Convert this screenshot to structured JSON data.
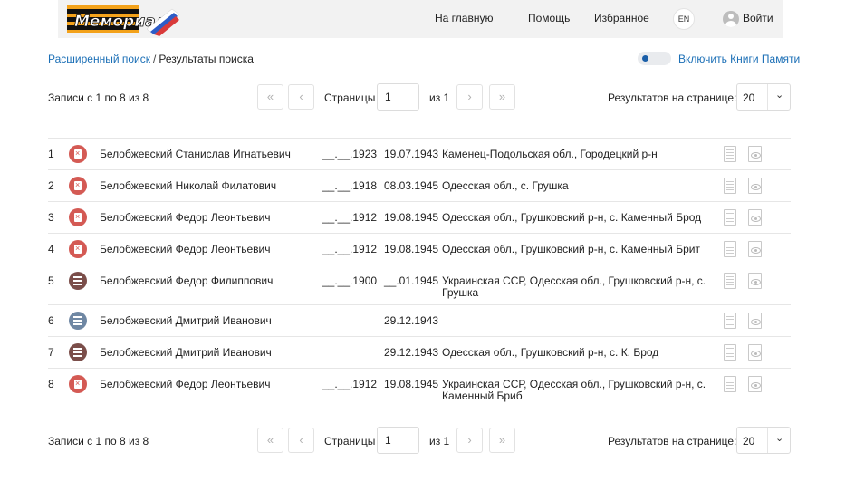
{
  "header": {
    "logo_text": "Мемориал",
    "nav": [
      {
        "label": "На главную"
      },
      {
        "label": "Помощь"
      },
      {
        "label": "Избранное"
      }
    ],
    "lang": "EN",
    "login": "Войти"
  },
  "breadcrumb": {
    "link": "Расширенный поиск",
    "separator": "/",
    "current": "Результаты поиска"
  },
  "memory_books": {
    "label": "Включить Книги Памяти",
    "enabled": false
  },
  "pagination": {
    "records": "Записи с 1 по 8 из 8",
    "first": "«",
    "prev": "‹",
    "next": "›",
    "last": "»",
    "pages_label": "Страницы",
    "page_value": "1",
    "of_label": "из 1",
    "per_page_label": "Результатов на странице:",
    "per_page_value": "20"
  },
  "rows": [
    {
      "num": "1",
      "icon": "red",
      "name": "Белобжевский Станислав Игнатьевич",
      "birth": "__.__.1923",
      "death": "19.07.1943",
      "place": "Каменец-Подольская обл., Городецкий р-н"
    },
    {
      "num": "2",
      "icon": "red",
      "name": "Белобжевский Николай Филатович",
      "birth": "__.__.1918",
      "death": "08.03.1945",
      "place": "Одесская обл., с. Грушка"
    },
    {
      "num": "3",
      "icon": "red",
      "name": "Белобжевский Федор Леонтьевич",
      "birth": "__.__.1912",
      "death": "19.08.1945",
      "place": "Одесская обл., Грушковский р-н, с. Каменный Брод"
    },
    {
      "num": "4",
      "icon": "red",
      "name": "Белобжевский Федор Леонтьевич",
      "birth": "__.__.1912",
      "death": "19.08.1945",
      "place": "Одесская обл., Грушковский р-н, с. Каменный Брит"
    },
    {
      "num": "5",
      "icon": "brown",
      "name": "Белобжевский Федор Филиппович",
      "birth": "__.__.1900",
      "death": "__.01.1945",
      "place": "Украинская ССР, Одесская обл., Грушковский р-н, с. Грушка"
    },
    {
      "num": "6",
      "icon": "blue",
      "name": "Белобжевский Дмитрий Иванович",
      "birth": "",
      "death": "29.12.1943",
      "place": ""
    },
    {
      "num": "7",
      "icon": "brown",
      "name": "Белобжевский Дмитрий Иванович",
      "birth": "",
      "death": "29.12.1943",
      "place": "Одесская обл., Грушковский р-н, с. К. Брод"
    },
    {
      "num": "8",
      "icon": "red",
      "name": "Белобжевский Федор Леонтьевич",
      "birth": "__.__.1912",
      "death": "19.08.1945",
      "place": "Украинская ССР, Одесская обл., Грушковский р-н, с. Каменный Бриб"
    }
  ],
  "colors": {
    "link": "#1b6fb6",
    "icon_red": "#d45a54",
    "icon_brown": "#7b4e4a",
    "icon_blue": "#6f87a3"
  }
}
